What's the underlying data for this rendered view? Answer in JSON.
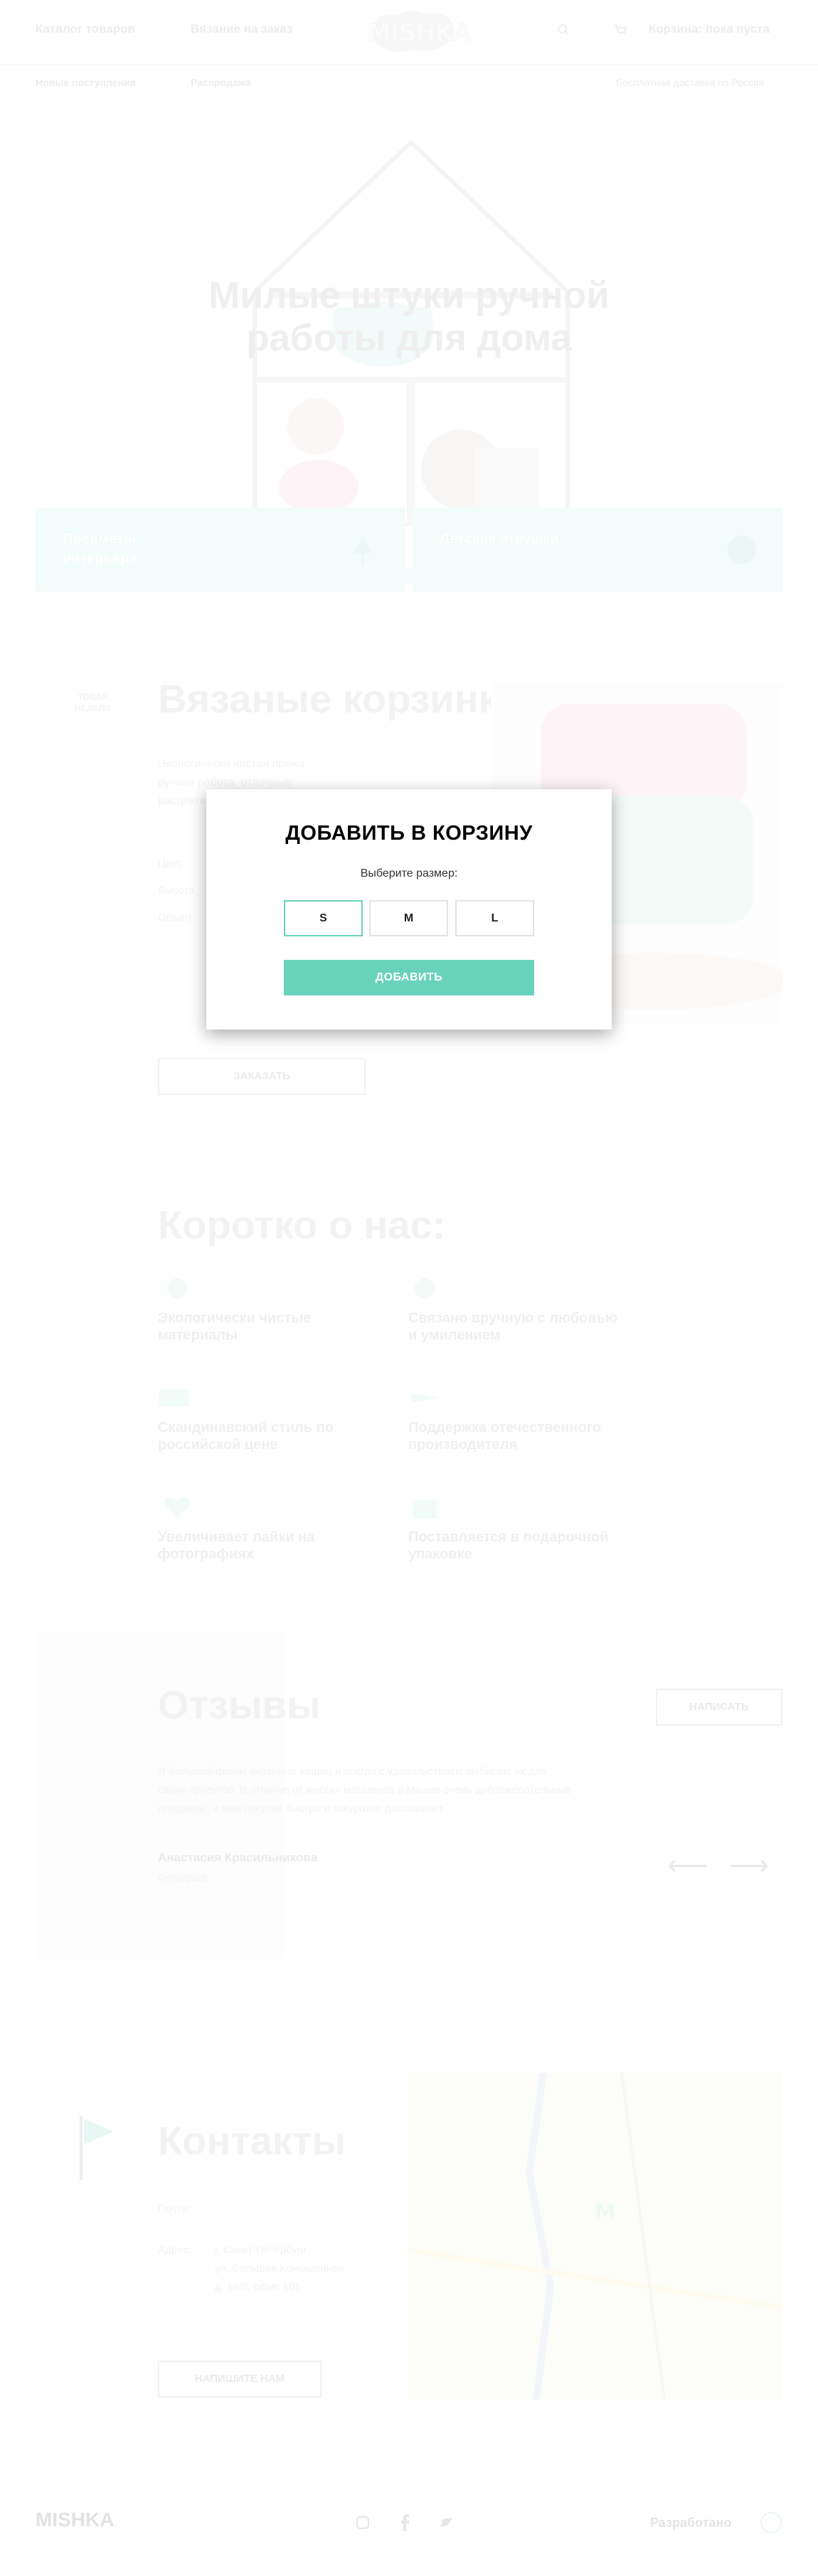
{
  "header": {
    "nav_catalog": "Каталог товаров",
    "nav_knitting": "Вязание на заказ",
    "logo": "MISHKA",
    "cart": "Корзина: пока пуста",
    "sub_new": "Новые поступления",
    "sub_sale": "Распродажа",
    "delivery": "Бесплатная доставка по России"
  },
  "hero": {
    "title": "Милые штуки ручной работы для дома",
    "card_interior": "Предметы интерьера",
    "card_toys": "Детские игрушки"
  },
  "product": {
    "badge": "ТОВАР НЕДЕЛИ",
    "title": "Вязаные корзинки",
    "desc_line1": "Экологически чистая пряжа,",
    "desc_line2": "ручная работа, отличные",
    "desc_line3": "расцветки",
    "spec_color": "Цвет",
    "spec_height": "Высота",
    "spec_volume": "Объем",
    "order_button": "ЗАКАЗАТЬ"
  },
  "about": {
    "title": "Коротко о нас:",
    "features": [
      {
        "label": "Экологически чистые материалы",
        "icon": "eco-icon"
      },
      {
        "label": "Связано вручную с любовью и умилением",
        "icon": "heart-hand-icon"
      },
      {
        "label": "Скандинавский стиль по российской цене",
        "icon": "money-icon"
      },
      {
        "label": "Поддержка отечественного производителя",
        "icon": "flag-icon"
      },
      {
        "label": "Увеличивает лайки на фотографиях",
        "icon": "like-icon"
      },
      {
        "label": "Поставляется в подарочной упаковке",
        "icon": "gift-icon"
      }
    ]
  },
  "reviews": {
    "title": "Отзывы",
    "write_button": "НАПИСАТЬ",
    "text_line1": "Я большой фанат вязанных вещиц и всегда с удовольствием выбираю их для",
    "text_line2": "своих проектов. В отличие от многих магазинов в Мишке очень доброжелательные",
    "text_line3": "продавцы, а мои покупки быстро и аккуратно доставляют.",
    "author": "Анастасия Красильникова",
    "author_role": "Фотограф",
    "prev": "⟵",
    "next": "⟶"
  },
  "contacts": {
    "title": "Контакты",
    "email_label": "Почта:",
    "address_label": "Адрес:",
    "address_line1": "г. Санкт-Петербург",
    "address_line2": "ул. Большая Конюшенная",
    "address_line3": "д. 19/8, офис 101",
    "write_button": "НАПИШИТЕ НАМ"
  },
  "footer": {
    "logo": "MISHKA",
    "developed": "Разработано"
  },
  "modal": {
    "title": "ДОБАВИТЬ В КОРЗИНУ",
    "subtitle": "Выберите размер:",
    "sizes": [
      "S",
      "M",
      "L"
    ],
    "selected_size": "S",
    "add_button": "ДОБАВИТЬ"
  },
  "colors": {
    "accent": "#68d2ba",
    "text_dark": "#000000",
    "faded": "#eeeeee"
  }
}
